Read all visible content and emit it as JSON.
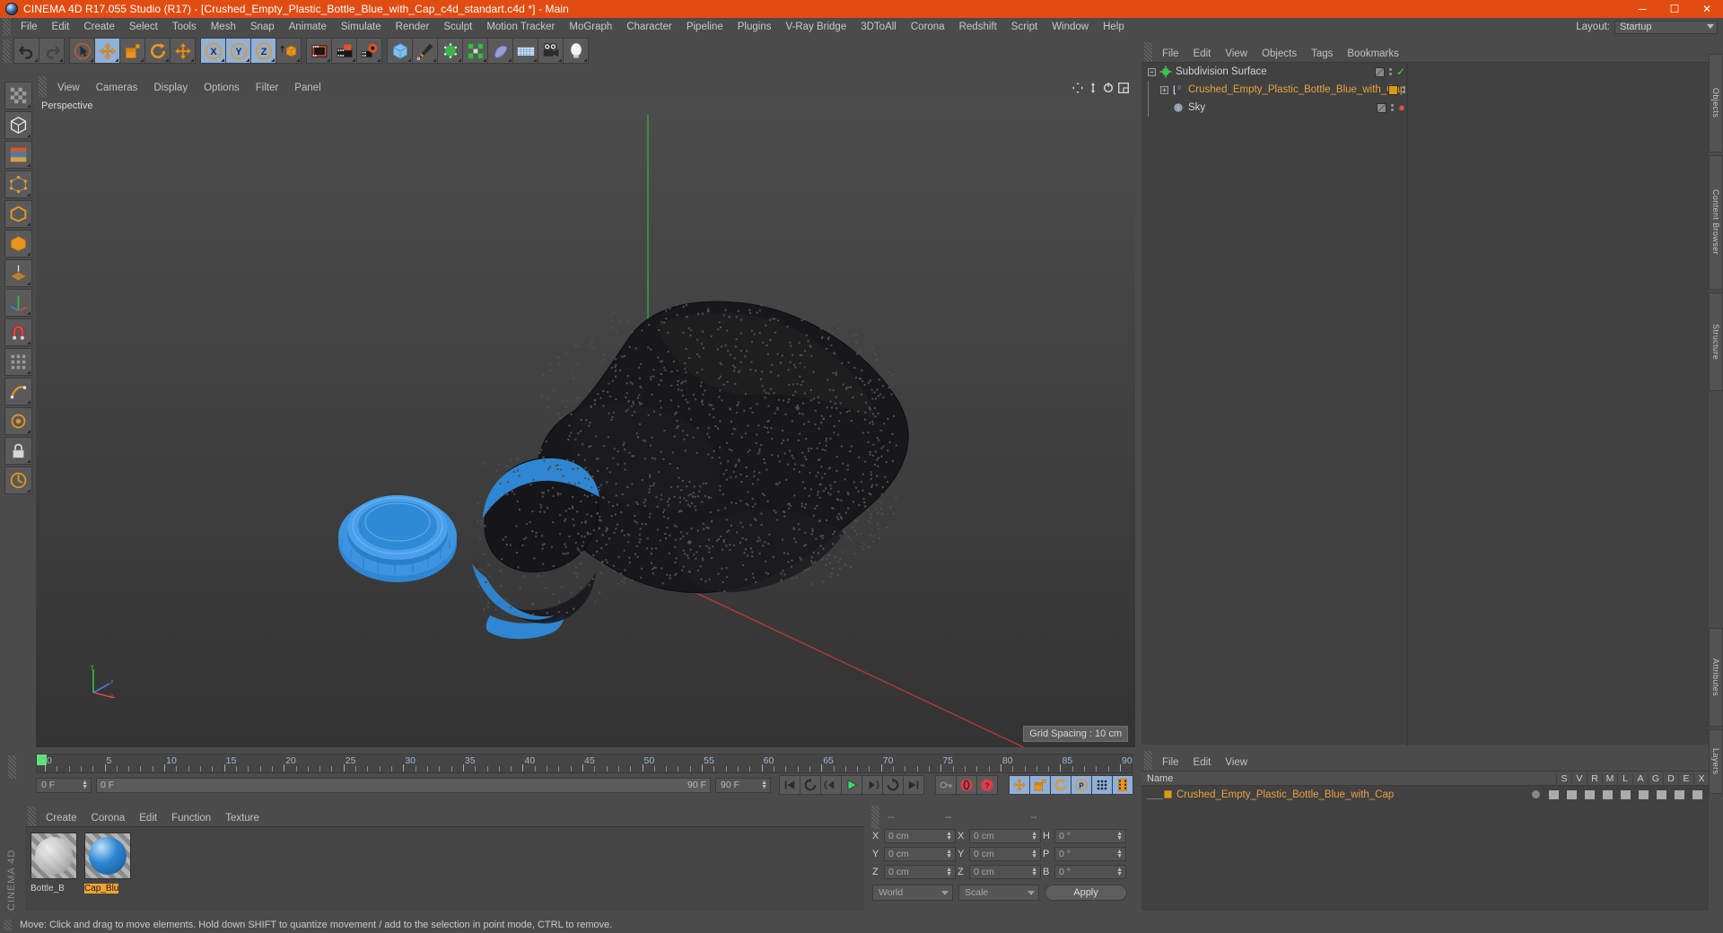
{
  "window": {
    "title": "CINEMA 4D R17.055 Studio (R17) - [Crushed_Empty_Plastic_Bottle_Blue_with_Cap_c4d_standart.c4d *] - Main",
    "minimize": "─",
    "maximize": "☐",
    "close": "✕",
    "accent": "#e14c12"
  },
  "menubar": {
    "items": [
      "File",
      "Edit",
      "Create",
      "Select",
      "Tools",
      "Mesh",
      "Snap",
      "Animate",
      "Simulate",
      "Render",
      "Sculpt",
      "Motion Tracker",
      "MoGraph",
      "Character",
      "Pipeline",
      "Plugins",
      "V-Ray Bridge",
      "3DToAll",
      "Corona",
      "Redshift",
      "Script",
      "Window",
      "Help"
    ],
    "layout_label": "Layout:",
    "layout_value": "Startup"
  },
  "toolbar": {
    "groups": [
      {
        "name": "undo-redo",
        "buttons": [
          {
            "name": "undo-button",
            "icon": "undo-icon",
            "active": false
          },
          {
            "name": "redo-button",
            "icon": "redo-icon",
            "active": false
          }
        ]
      },
      {
        "name": "transform-tools",
        "buttons": [
          {
            "name": "select-tool",
            "icon": "cursor-icon",
            "active": false
          },
          {
            "name": "move-tool",
            "icon": "move-icon",
            "active": true
          },
          {
            "name": "scale-tool",
            "icon": "scale-icon",
            "active": false
          },
          {
            "name": "rotate-tool",
            "icon": "rotate-icon",
            "active": false
          },
          {
            "name": "dynamic-place-tool",
            "icon": "move-icon",
            "active": false
          }
        ]
      },
      {
        "name": "axis-locks",
        "buttons": [
          {
            "name": "lock-x-axis",
            "icon": "x-axis-icon",
            "active": true
          },
          {
            "name": "lock-y-axis",
            "icon": "y-axis-icon",
            "active": true
          },
          {
            "name": "lock-z-axis",
            "icon": "z-axis-icon",
            "active": true
          },
          {
            "name": "world-object-coordinates",
            "icon": "world-cube-icon",
            "active": false
          }
        ]
      },
      {
        "name": "render-tools",
        "buttons": [
          {
            "name": "render-view-button",
            "icon": "render-view-icon",
            "active": false
          },
          {
            "name": "render-to-picture-viewer",
            "icon": "render-picture-icon",
            "active": false
          },
          {
            "name": "render-settings",
            "icon": "render-settings-icon",
            "active": false
          }
        ]
      },
      {
        "name": "create-objects",
        "buttons": [
          {
            "name": "add-cube-object",
            "icon": "cube-icon",
            "active": false
          },
          {
            "name": "add-spline",
            "icon": "pen-icon",
            "active": false
          },
          {
            "name": "add-generator",
            "icon": "nurbs-icon",
            "active": false
          },
          {
            "name": "add-array",
            "icon": "array-icon",
            "active": false
          },
          {
            "name": "add-deformer",
            "icon": "bend-icon",
            "active": false
          },
          {
            "name": "add-scene-floor",
            "icon": "floor-icon",
            "active": false
          },
          {
            "name": "add-camera",
            "icon": "camera-icon",
            "active": false
          },
          {
            "name": "add-light",
            "icon": "light-icon",
            "active": false
          }
        ]
      }
    ]
  },
  "left_rail": {
    "buttons": [
      {
        "name": "model-mode",
        "icon": "checker-icon"
      },
      {
        "name": "object-mode",
        "icon": "cube-outline-icon"
      },
      {
        "name": "texture-mode",
        "icon": "texture-icon"
      },
      {
        "name": "points-mode",
        "icon": "points-icon"
      },
      {
        "name": "edges-mode",
        "icon": "edges-icon"
      },
      {
        "name": "polygons-mode",
        "icon": "polygons-icon"
      },
      {
        "name": "workplane-mode",
        "icon": "workplane-icon"
      },
      {
        "name": "enable-axis",
        "icon": "axis-icon"
      },
      {
        "name": "enable-snap",
        "icon": "magnet-icon"
      },
      {
        "name": "subdivision-toggle",
        "icon": "subdivision-icon"
      },
      {
        "name": "deformer-toggle",
        "icon": "deformer-icon"
      },
      {
        "name": "viewport-solo",
        "icon": "solo-icon"
      },
      {
        "name": "lock-axis",
        "icon": "lock-icon"
      },
      {
        "name": "quantize",
        "icon": "quantize-icon"
      }
    ]
  },
  "viewport": {
    "menu": [
      "View",
      "Cameras",
      "Display",
      "Options",
      "Filter",
      "Panel"
    ],
    "camera_label": "Perspective",
    "grid_spacing": "Grid Spacing : 10 cm",
    "corner_icons": [
      "pan-icon",
      "dolly-icon",
      "rotate-view-icon",
      "maximize-view-icon"
    ]
  },
  "object_manager": {
    "menu": [
      "File",
      "Edit",
      "View",
      "Objects",
      "Tags",
      "Bookmarks"
    ],
    "rows": [
      {
        "name": "Subdivision Surface",
        "icon": "subdivision-surface-icon",
        "depth": 0,
        "expander": "minus",
        "selected": false,
        "tag_check": true,
        "tag_color": "#7a7a7a"
      },
      {
        "name": "Crushed_Empty_Plastic_Bottle_Blue_with_Cap",
        "icon": "polygon-object-icon",
        "depth": 1,
        "expander": "plus",
        "selected": true,
        "tag_check": false,
        "tag_color": "#d99a14"
      },
      {
        "name": "Sky",
        "icon": "sky-icon",
        "depth": 1,
        "expander": "none",
        "selected": false,
        "tag_check": false,
        "tag_color": "#7a7a7a"
      }
    ]
  },
  "bottom_right_manager": {
    "menu": [
      "File",
      "Edit",
      "View"
    ],
    "columns": [
      "Name",
      "S",
      "V",
      "R",
      "M",
      "L",
      "A",
      "G",
      "D",
      "E",
      "X"
    ],
    "rows": [
      {
        "name": "Crushed_Empty_Plastic_Bottle_Blue_with_Cap",
        "icon": "layer-color-icon"
      }
    ]
  },
  "timeline": {
    "labels": [
      "0",
      "5",
      "10",
      "15",
      "20",
      "25",
      "30",
      "35",
      "40",
      "45",
      "50",
      "55",
      "60",
      "65",
      "70",
      "75",
      "80",
      "85",
      "90"
    ],
    "start_frame": "0 F",
    "current_frame": "0 F",
    "end_frame_left": "90 F",
    "end_frame_field": "90 F",
    "transport": [
      {
        "name": "go-to-start-button",
        "icon": "skip-start-icon"
      },
      {
        "name": "play-backwards-loop-button",
        "icon": "loop-back-icon"
      },
      {
        "name": "previous-frame-button",
        "icon": "step-back-icon"
      },
      {
        "name": "play-button",
        "icon": "play-icon"
      },
      {
        "name": "next-frame-button",
        "icon": "step-forward-icon"
      },
      {
        "name": "play-forward-loop-button",
        "icon": "loop-forward-icon"
      },
      {
        "name": "go-to-end-button",
        "icon": "skip-end-icon"
      }
    ],
    "record_group": [
      {
        "name": "autokeying-button",
        "icon": "key-icon",
        "active": false
      },
      {
        "name": "record-active-objects-button",
        "icon": "record-icon",
        "active": false
      },
      {
        "name": "keyframe-selection-button",
        "icon": "question-icon",
        "active": false
      }
    ],
    "param_group": [
      {
        "name": "position-key-button",
        "icon": "move-icon",
        "active": true
      },
      {
        "name": "scale-key-button",
        "icon": "scale-icon",
        "active": true
      },
      {
        "name": "rotation-key-button",
        "icon": "rotate-icon",
        "active": true
      },
      {
        "name": "parameter-key-button",
        "icon": "p-circle-icon",
        "active": true
      },
      {
        "name": "point-level-animation-button",
        "icon": "dots-grid-icon",
        "active": true
      },
      {
        "name": "timeline-view-button",
        "icon": "film-icon",
        "active": true
      }
    ]
  },
  "material_manager": {
    "menu": [
      "Create",
      "Corona",
      "Edit",
      "Function",
      "Texture"
    ],
    "materials": [
      {
        "label": "Bottle_B",
        "selected": false,
        "swatch": "glass",
        "color": "#cfcfcf"
      },
      {
        "label": "Cap_Blu",
        "selected": true,
        "swatch": "sphere",
        "color": "#2f86d2"
      }
    ]
  },
  "coordinates": {
    "headers": [
      "--",
      "--",
      "--"
    ],
    "rows": [
      {
        "axis1": "X",
        "val1": "0 cm",
        "axis2": "X",
        "val2": "0 cm",
        "axis3": "H",
        "val3": "0 °"
      },
      {
        "axis1": "Y",
        "val1": "0 cm",
        "axis2": "Y",
        "val2": "0 cm",
        "axis3": "P",
        "val3": "0 °"
      },
      {
        "axis1": "Z",
        "val1": "0 cm",
        "axis2": "Z",
        "val2": "0 cm",
        "axis3": "B",
        "val3": "0 °"
      }
    ],
    "system": "World",
    "mode": "Scale",
    "apply": "Apply"
  },
  "side_tabs": {
    "right": [
      "Objects",
      "Content Browser",
      "Structure"
    ],
    "right_lower": [
      "Attributes",
      "Layers"
    ]
  },
  "brand": "CINEMA 4D",
  "status_bar": {
    "text": "Move: Click and drag to move elements. Hold down SHIFT to quantize movement / add to the selection in point mode, CTRL to remove."
  }
}
